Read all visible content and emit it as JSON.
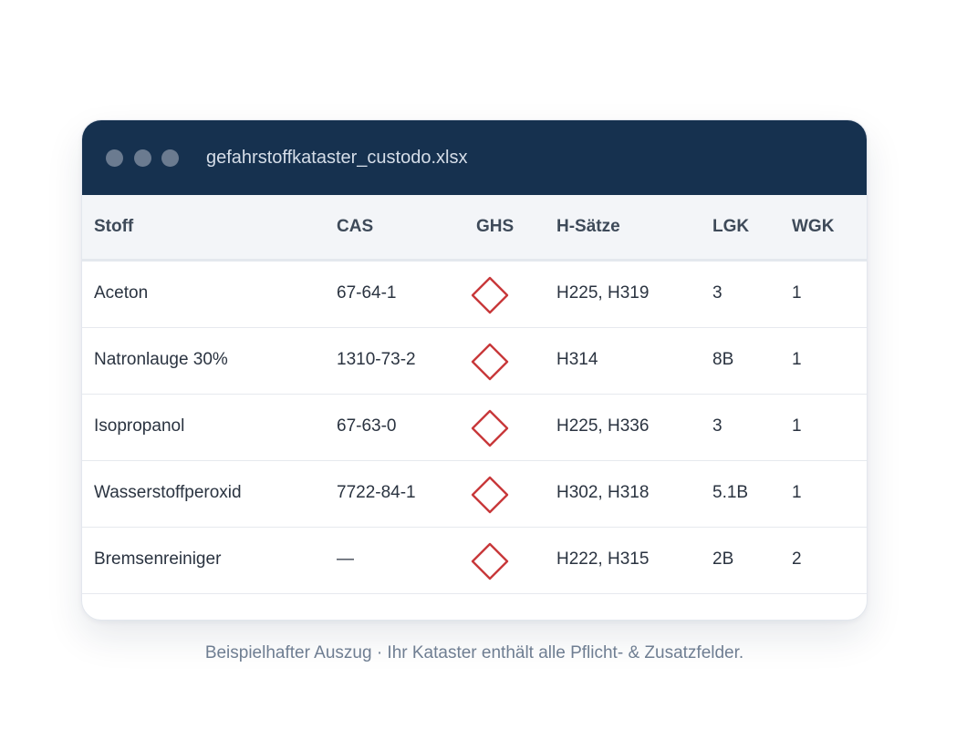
{
  "window": {
    "filename": "gefahrstoffkataster_custodo.xlsx"
  },
  "table": {
    "headers": {
      "stoff": "Stoff",
      "cas": "CAS",
      "ghs": "GHS",
      "h_saetze": "H-Sätze",
      "lgk": "LGK",
      "wgk": "WGK"
    },
    "rows": [
      {
        "stoff": "Aceton",
        "cas": "67-64-1",
        "ghs_icon": "ghs-pictogram-diamond-icon",
        "h_saetze": "H225, H319",
        "lgk": "3",
        "wgk": "1"
      },
      {
        "stoff": "Natronlauge 30%",
        "cas": "1310-73-2",
        "ghs_icon": "ghs-pictogram-diamond-icon",
        "h_saetze": "H314",
        "lgk": "8B",
        "wgk": "1"
      },
      {
        "stoff": "Isopropanol",
        "cas": "67-63-0",
        "ghs_icon": "ghs-pictogram-diamond-icon",
        "h_saetze": "H225, H336",
        "lgk": "3",
        "wgk": "1"
      },
      {
        "stoff": "Wasserstoffperoxid",
        "cas": "7722-84-1",
        "ghs_icon": "ghs-pictogram-diamond-icon",
        "h_saetze": "H302, H318",
        "lgk": "5.1B",
        "wgk": "1"
      },
      {
        "stoff": "Bremsenreiniger",
        "cas": "—",
        "ghs_icon": "ghs-pictogram-diamond-icon",
        "h_saetze": "H222, H315",
        "lgk": "2B",
        "wgk": "2"
      }
    ]
  },
  "caption": "Beispielhafter Auszug · Ihr Kataster enthält alle Pflicht- & Zusatzfelder.",
  "colors": {
    "titlebar": "#16314f",
    "ghs_red": "#c8383a",
    "header_bg": "#f3f5f8"
  }
}
